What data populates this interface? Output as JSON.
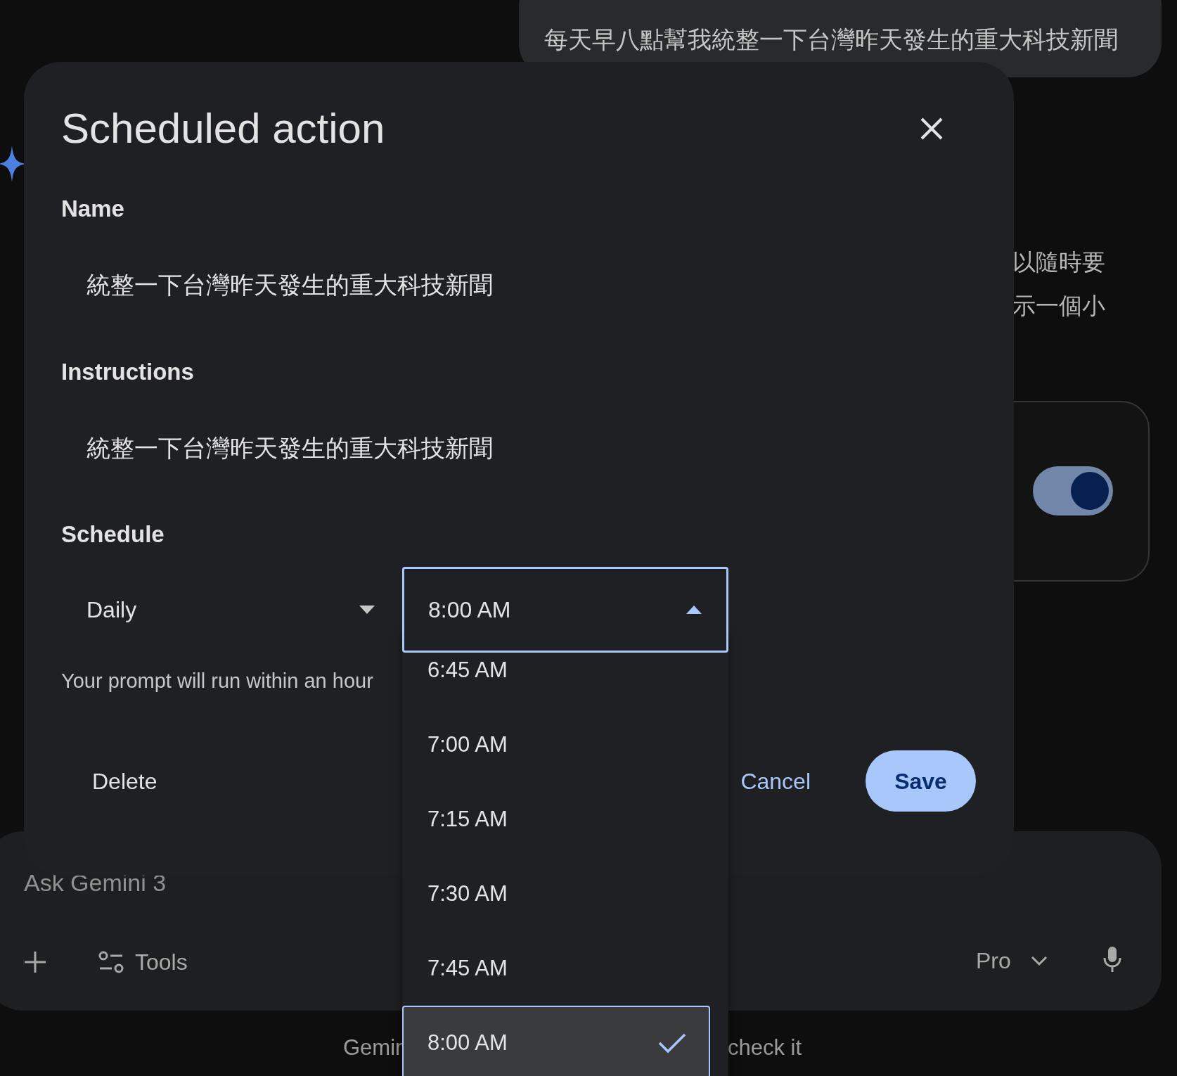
{
  "chat": {
    "user_message": "每天早八點幫我統整一下台灣昨天發生的重大科技新聞",
    "response_lines": [
      "以隨時要",
      "示一個小"
    ],
    "card": {
      "toggle_on": true
    }
  },
  "composer": {
    "placeholder": "Ask Gemini 3",
    "tools_label": "Tools",
    "model": "Pro"
  },
  "disclaimer": [
    "Gemin",
    "check it"
  ],
  "dialog": {
    "title": "Scheduled action",
    "fields": [
      {
        "label": "Name",
        "value": "統整一下台灣昨天發生的重大科技新聞"
      },
      {
        "label": "Instructions",
        "value": "統整一下台灣昨天發生的重大科技新聞"
      }
    ],
    "schedule": {
      "label": "Schedule",
      "frequency": "Daily",
      "time": "8:00 AM",
      "expanded": true,
      "helper": "Your prompt will run within an hour"
    },
    "buttons": {
      "delete": "Delete",
      "cancel": "Cancel",
      "save": "Save"
    }
  },
  "time_options": [
    {
      "label": "6:45 AM",
      "selected": false
    },
    {
      "label": "7:00 AM",
      "selected": false
    },
    {
      "label": "7:15 AM",
      "selected": false
    },
    {
      "label": "7:30 AM",
      "selected": false
    },
    {
      "label": "7:45 AM",
      "selected": false
    },
    {
      "label": "8:00 AM",
      "selected": true
    }
  ]
}
